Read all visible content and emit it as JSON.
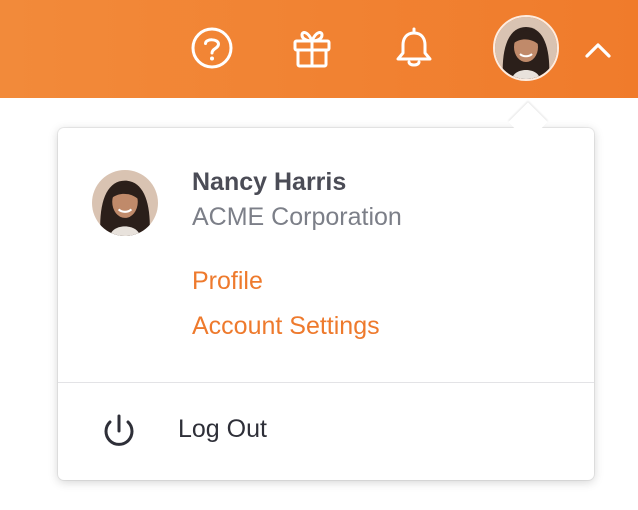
{
  "header": {
    "help_icon": "help-circle-icon",
    "gift_icon": "gift-icon",
    "notifications_icon": "bell-icon",
    "account_avatar": "avatar",
    "menu_toggle_icon": "chevron-up-icon",
    "background_color": "#f07b2b",
    "icon_color": "#ffffff"
  },
  "account_menu": {
    "user": {
      "name": "Nancy Harris",
      "company": "ACME Corporation"
    },
    "links": [
      {
        "label": "Profile"
      },
      {
        "label": "Account Settings"
      }
    ],
    "logout": {
      "label": "Log Out",
      "icon": "power-icon"
    },
    "colors": {
      "link": "#ee7a2d",
      "name": "#4b4c56",
      "company": "#7c7f88"
    }
  }
}
